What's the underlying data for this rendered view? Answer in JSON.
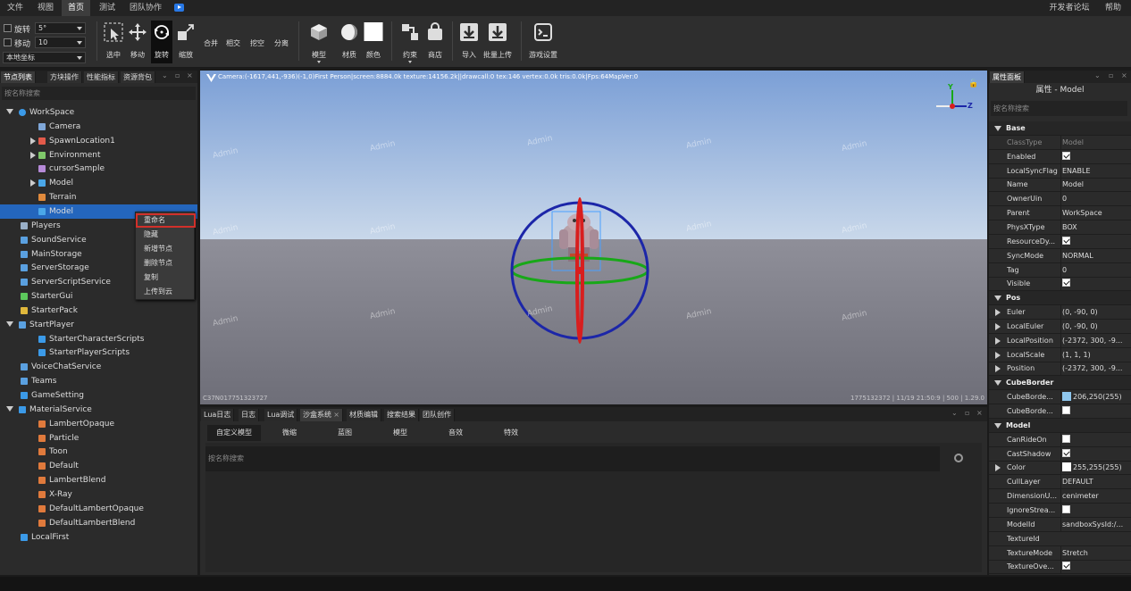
{
  "menu": {
    "items": [
      "文件",
      "视图",
      "首页",
      "测试",
      "团队协作"
    ],
    "active": "首页",
    "right_items": [
      "开发者论坛",
      "帮助"
    ]
  },
  "toolbar": {
    "rotate_label": "旋转",
    "rotate_value": "5°",
    "move_label": "移动",
    "move_value": "10",
    "coord_value": "本地坐标",
    "tools": [
      "选中",
      "移动",
      "旋转",
      "缩放"
    ],
    "active_tool": "旋转",
    "csg": [
      "合并",
      "相交",
      "挖空",
      "分离"
    ],
    "insert": [
      "模型",
      "材质",
      "颜色"
    ],
    "constraint": [
      "约束",
      "商店"
    ],
    "io": [
      "导入",
      "批量上传"
    ],
    "settings": "游戏设置"
  },
  "left_panel": {
    "tabs": [
      "节点列表",
      "方块操作",
      "性能指标",
      "资源背包"
    ],
    "search_placeholder": "按名称搜索",
    "tree": [
      {
        "label": "WorkSpace",
        "icon": "globe-icon",
        "color": "#3b9ae8",
        "twisty": "down"
      },
      {
        "label": "Camera",
        "icon": "camera-icon",
        "color": "#7fa7d8"
      },
      {
        "label": "SpawnLocation1",
        "icon": "spawn-icon",
        "color": "#e25a4a",
        "twisty": "right"
      },
      {
        "label": "Environment",
        "icon": "environment-icon",
        "color": "#7fc86a",
        "twisty": "right"
      },
      {
        "label": "cursorSample",
        "icon": "cube-icon",
        "color": "#b68ad8"
      },
      {
        "label": "Model",
        "icon": "model-icon",
        "color": "#4aa7e8",
        "twisty": "right"
      },
      {
        "label": "Terrain",
        "icon": "terrain-icon",
        "color": "#e08a3c"
      },
      {
        "label": "Model",
        "icon": "model-icon",
        "color": "#4aa7e8",
        "selected": true
      },
      {
        "label": "Players",
        "icon": "players-icon",
        "color": "#9ab0c8"
      },
      {
        "label": "SoundService",
        "icon": "sound-icon",
        "color": "#5aa0e0"
      },
      {
        "label": "MainStorage",
        "icon": "storage-icon",
        "color": "#5aa0e0"
      },
      {
        "label": "ServerStorage",
        "icon": "storage-icon",
        "color": "#5aa0e0"
      },
      {
        "label": "ServerScriptService",
        "icon": "script-service-icon",
        "color": "#5aa0e0"
      },
      {
        "label": "StarterGui",
        "icon": "gui-icon",
        "color": "#5cc85c"
      },
      {
        "label": "StarterPack",
        "icon": "pack-icon",
        "color": "#e0b83c"
      },
      {
        "label": "StartPlayer",
        "icon": "start-player-icon",
        "color": "#5aa0e0",
        "twisty": "down"
      },
      {
        "label": "StarterCharacterScripts",
        "icon": "script-icon",
        "color": "#3b9ae8"
      },
      {
        "label": "StarterPlayerScripts",
        "icon": "script-icon",
        "color": "#3b9ae8"
      },
      {
        "label": "VoiceChatService",
        "icon": "voice-icon",
        "color": "#5aa0e0"
      },
      {
        "label": "Teams",
        "icon": "teams-icon",
        "color": "#5aa0e0"
      },
      {
        "label": "GameSetting",
        "icon": "setting-icon",
        "color": "#3b9ae8"
      },
      {
        "label": "MaterialService",
        "icon": "material-icon",
        "color": "#3b9ae8",
        "twisty": "down"
      },
      {
        "label": "LambertOpaque",
        "icon": "material-item-icon",
        "color": "#e07a3c"
      },
      {
        "label": "Particle",
        "icon": "material-item-icon",
        "color": "#e07a3c"
      },
      {
        "label": "Toon",
        "icon": "material-item-icon",
        "color": "#e07a3c"
      },
      {
        "label": "Default",
        "icon": "material-item-icon",
        "color": "#e07a3c"
      },
      {
        "label": "LambertBlend",
        "icon": "material-item-icon",
        "color": "#e07a3c"
      },
      {
        "label": "X-Ray",
        "icon": "material-item-icon",
        "color": "#e07a3c"
      },
      {
        "label": "DefaultLambertOpaque",
        "icon": "material-item-icon",
        "color": "#e07a3c"
      },
      {
        "label": "DefaultLambertBlend",
        "icon": "material-item-icon",
        "color": "#e07a3c"
      },
      {
        "label": "LocalFirst",
        "icon": "script-icon",
        "color": "#3b9ae8"
      }
    ]
  },
  "context_menu": {
    "items": [
      "重命名",
      "隐藏",
      "新增节点",
      "删除节点",
      "复制",
      "上传到云"
    ],
    "highlighted": "重命名"
  },
  "viewport": {
    "info": "Camera:(-1617,441,-936)(-1,0)First Person|screen:8884.0k texture:14156.2k||drawcall:0 tex:146 vertex:0.0k tris:0.0k|Fps:64MapVer:0",
    "watermark": "Admin",
    "bottom_left": "C37N017751323727",
    "bottom_right": "1775132372 | 11/19 21:50:9 | 500 | 1.29.0",
    "axis_y": "Y",
    "axis_z": "Z"
  },
  "bottom_panel": {
    "tabs": [
      "Lua日志",
      "日志",
      "Lua调试",
      "沙盒系统",
      "材质编辑",
      "搜索结果",
      "团队创作"
    ],
    "active_tab": "沙盒系统",
    "categories": [
      "自定义模型",
      "微缩",
      "蓝图",
      "模型",
      "音效",
      "特效"
    ],
    "active_category": "自定义模型",
    "search_placeholder": "按名称搜索"
  },
  "properties": {
    "tab": "属性面板",
    "title": "属性 - Model",
    "search_placeholder": "按名称搜索",
    "rows": [
      {
        "section": "Base"
      },
      {
        "k": "ClassType",
        "v": "Model",
        "dim": true
      },
      {
        "k": "Enabled",
        "check": true
      },
      {
        "k": "LocalSyncFlag",
        "v": "ENABLE"
      },
      {
        "k": "Name",
        "v": "Model"
      },
      {
        "k": "OwnerUin",
        "v": "0"
      },
      {
        "k": "Parent",
        "v": "WorkSpace"
      },
      {
        "k": "PhysXType",
        "v": "BOX"
      },
      {
        "k": "ResourceDy...",
        "check": true
      },
      {
        "k": "SyncMode",
        "v": "NORMAL"
      },
      {
        "k": "Tag",
        "v": "0"
      },
      {
        "k": "Visible",
        "check": true
      },
      {
        "section": "Pos"
      },
      {
        "k": "Euler",
        "v": "(0, -90, 0)",
        "exp": true
      },
      {
        "k": "LocalEuler",
        "v": "(0, -90, 0)",
        "exp": true
      },
      {
        "k": "LocalPosition",
        "v": "(-2372, 300, -9...",
        "exp": true
      },
      {
        "k": "LocalScale",
        "v": "(1, 1, 1)",
        "exp": true
      },
      {
        "k": "Position",
        "v": "(-2372, 300, -9...",
        "exp": true
      },
      {
        "section": "CubeBorder"
      },
      {
        "k": "CubeBorde...",
        "v": "206,250(255)",
        "swatch": "#8fc7ee"
      },
      {
        "k": "CubeBorde...",
        "check": false
      },
      {
        "section": "Model"
      },
      {
        "k": "CanRideOn",
        "check": false
      },
      {
        "k": "CastShadow",
        "check": true
      },
      {
        "k": "Color",
        "v": "255,255(255)",
        "swatch": "#ffffff",
        "exp": true
      },
      {
        "k": "CullLayer",
        "v": "DEFAULT"
      },
      {
        "k": "DimensionU...",
        "v": "cenimeter"
      },
      {
        "k": "IgnoreStrea...",
        "check": false
      },
      {
        "k": "ModelId",
        "v": "sandboxSysId:/..."
      },
      {
        "k": "TextureId",
        "v": ""
      },
      {
        "k": "TextureMode",
        "v": "Stretch"
      },
      {
        "k": "TextureOve...",
        "check": true
      }
    ]
  },
  "colors": {
    "accent": "#2466bd",
    "highlight": "#d2302a",
    "gizmo_red": "#d81e1e",
    "gizmo_green": "#18a818",
    "gizmo_blue": "#1c26a8"
  }
}
